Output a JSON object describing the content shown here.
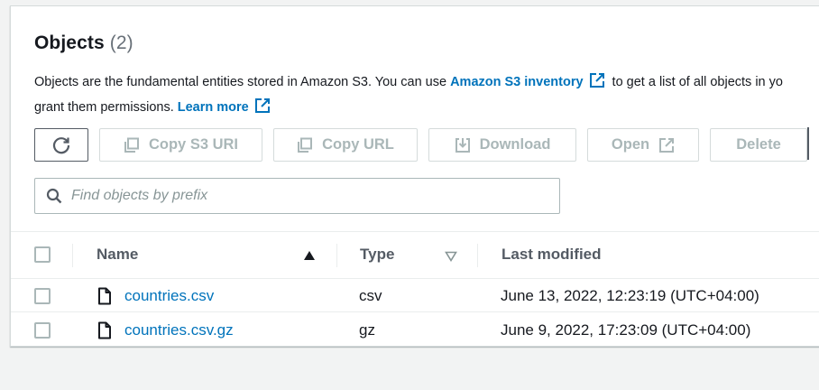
{
  "header": {
    "title": "Objects",
    "count": "(2)"
  },
  "description": {
    "text1": "Objects are the fundamental entities stored in Amazon S3. You can use ",
    "link1": "Amazon S3 inventory",
    "text2": " to get a list of all objects in yo",
    "text3": "grant them permissions. ",
    "link2": "Learn more"
  },
  "toolbar": {
    "refresh_icon": "refresh-icon",
    "copy_s3_uri": "Copy S3 URI",
    "copy_url": "Copy URL",
    "download": "Download",
    "open": "Open",
    "delete": "Delete"
  },
  "search": {
    "placeholder": "Find objects by prefix",
    "value": ""
  },
  "table": {
    "columns": {
      "name": "Name",
      "type": "Type",
      "last_modified": "Last modified"
    },
    "sort": {
      "name": "ascending",
      "type": "unsorted"
    },
    "rows": [
      {
        "name": "countries.csv",
        "type": "csv",
        "last_modified": "June 13, 2022, 12:23:19 (UTC+04:00)"
      },
      {
        "name": "countries.csv.gz",
        "type": "gz",
        "last_modified": "June 9, 2022, 17:23:09 (UTC+04:00)"
      }
    ]
  },
  "colors": {
    "link": "#0073bb",
    "disabled": "#aab7b8",
    "text": "#16191f",
    "background": "#f2f3f3"
  }
}
